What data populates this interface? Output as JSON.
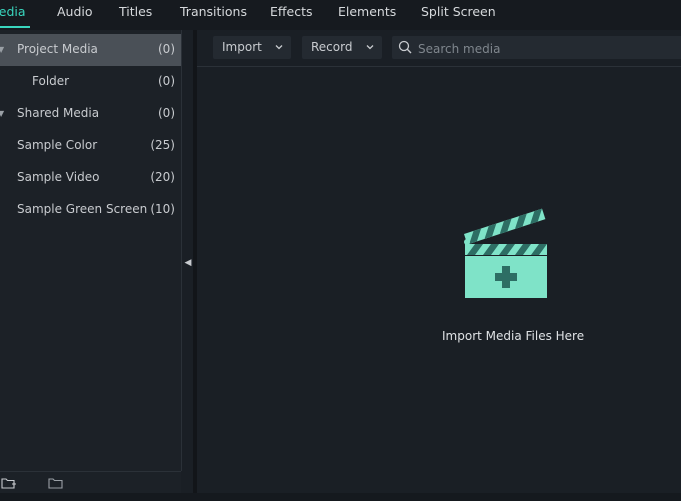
{
  "tabs": [
    {
      "label": "Media",
      "active": true
    },
    {
      "label": "Audio",
      "active": false
    },
    {
      "label": "Titles",
      "active": false
    },
    {
      "label": "Transitions",
      "active": false
    },
    {
      "label": "Effects",
      "active": false
    },
    {
      "label": "Elements",
      "active": false
    },
    {
      "label": "Split Screen",
      "active": false
    }
  ],
  "sidebar": {
    "items": [
      {
        "label": "Project Media",
        "count": "(0)",
        "selected": true,
        "expandable": true
      },
      {
        "label": "Folder",
        "count": "(0)",
        "selected": false,
        "expandable": false
      },
      {
        "label": "Shared Media",
        "count": "(0)",
        "selected": false,
        "expandable": true
      },
      {
        "label": "Sample Color",
        "count": "(25)",
        "selected": false,
        "expandable": false
      },
      {
        "label": "Sample Video",
        "count": "(20)",
        "selected": false,
        "expandable": false
      },
      {
        "label": "Sample Green Screen",
        "count": "(10)",
        "selected": false,
        "expandable": false
      }
    ]
  },
  "toolbar": {
    "import_label": "Import",
    "record_label": "Record",
    "search_placeholder": "Search media"
  },
  "empty_state": {
    "text": "Import Media Files Here",
    "icon": "clapperboard-plus-icon"
  },
  "colors": {
    "accent": "#39d6be",
    "illustration": "#7fe3c8",
    "background": "#1a1f25",
    "selected_item": "#4a5057"
  }
}
